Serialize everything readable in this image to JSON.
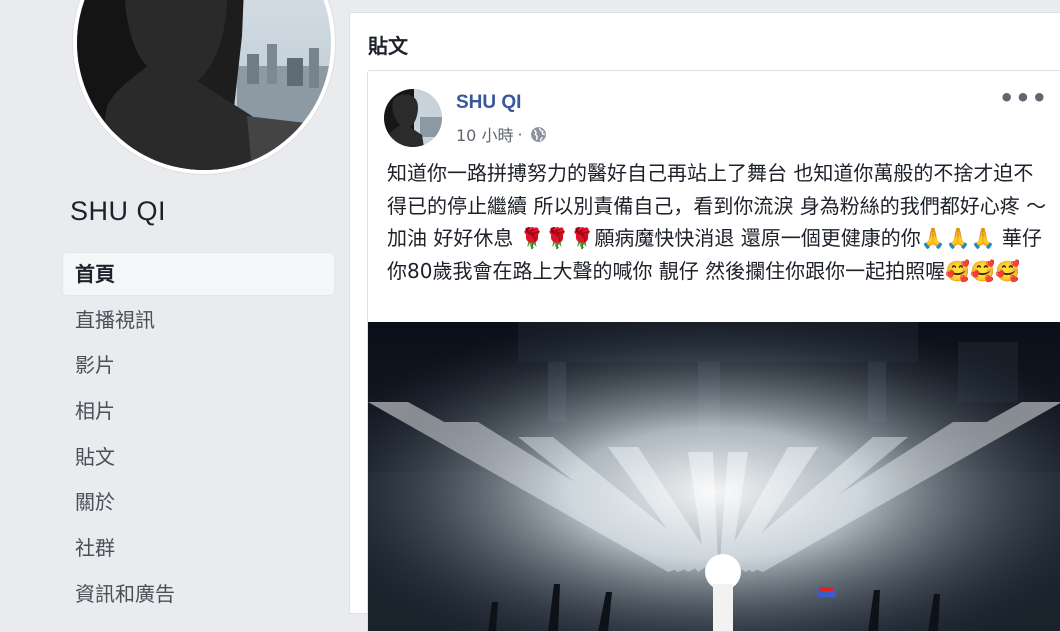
{
  "page": {
    "name": "SHU QI"
  },
  "nav": {
    "items": [
      {
        "label": "首頁",
        "active": true
      },
      {
        "label": "直播視訊"
      },
      {
        "label": "影片"
      },
      {
        "label": "相片"
      },
      {
        "label": "貼文"
      },
      {
        "label": "關於"
      },
      {
        "label": "社群"
      },
      {
        "label": "資訊和廣告"
      }
    ]
  },
  "posts": {
    "heading": "貼文",
    "post": {
      "author": "SHU QI",
      "time": "10 小時",
      "separator": "·",
      "privacy_icon": "globe-icon",
      "more_icon": "more-icon",
      "text_part1": "知道你一路拼搏努力的醫好自己再站上了舞台 也知道你萬般的不捨才迫不得已的停止繼續 所以別責備自己，看到你流淚 身為粉絲的我們都好心疼 ～ 加油 好好休息 ",
      "flowers": "🌹🌹🌹",
      "text_part2": "願病魔快快消退 還原一個更健康的你",
      "prays": "🙏🙏🙏",
      "text_part3": " 華仔 你80歲我會在路上大聲的喊你 靚仔 然後攔住你跟你一起拍照喔",
      "loves": "🥰🥰🥰"
    }
  },
  "colors": {
    "background": "#e9ebee",
    "link": "#385898",
    "text": "#1d2129",
    "muted": "#606770"
  }
}
